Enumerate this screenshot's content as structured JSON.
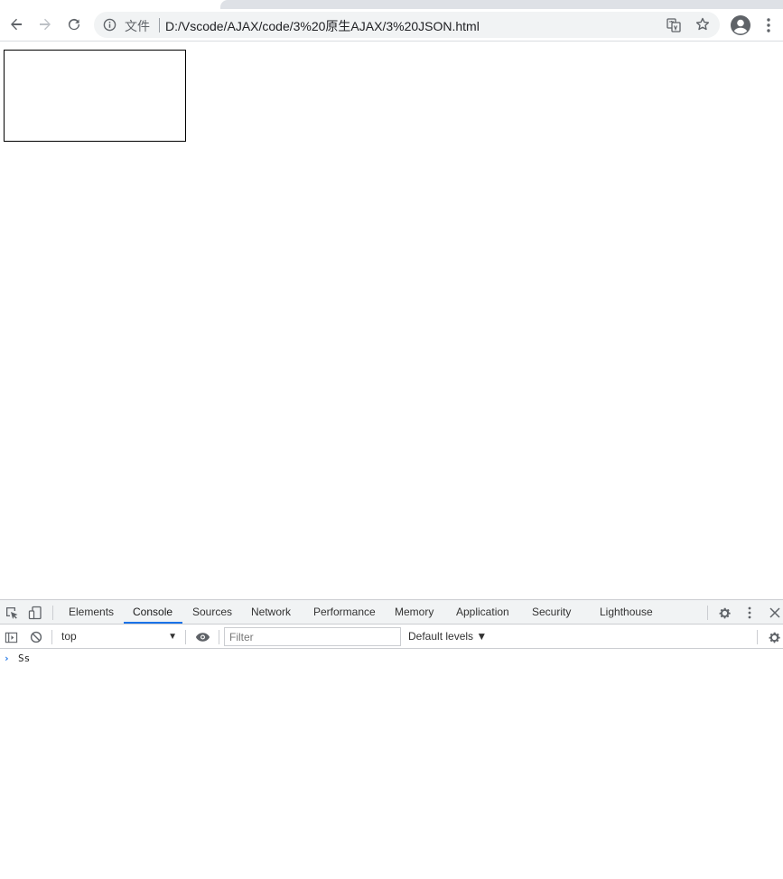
{
  "browser": {
    "omnibox": {
      "scheme_label": "文件",
      "url": "D:/Vscode/AJAX/code/3%20原生AJAX/3%20JSON.html"
    },
    "icons": {
      "back": "arrow-left-icon",
      "forward": "arrow-right-icon",
      "reload": "reload-icon",
      "info": "info-icon",
      "translate": "translate-icon",
      "bookmark": "star-icon",
      "profile": "account-icon",
      "menu": "kebab-menu-icon"
    }
  },
  "devtools": {
    "tabs": [
      "Elements",
      "Console",
      "Sources",
      "Network",
      "Performance",
      "Memory",
      "Application",
      "Security",
      "Lighthouse"
    ],
    "active_tab": "Console",
    "accent_color": "#1a73e8",
    "console_toolbar": {
      "context": "top",
      "filter_placeholder": "Filter",
      "levels": "Default levels ▼"
    },
    "console": {
      "prompt_input": "Ss"
    }
  }
}
